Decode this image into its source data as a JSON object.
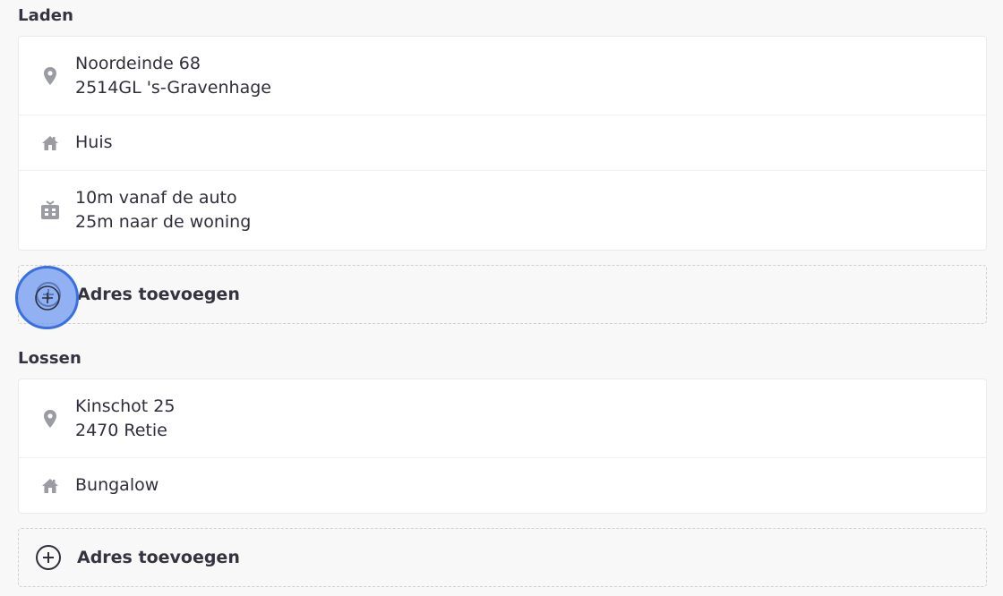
{
  "sections": [
    {
      "title": "Laden",
      "rows": [
        {
          "icon": "location-pin-icon",
          "lines": [
            "Noordeinde 68",
            "2514GL 's-Gravenhage"
          ]
        },
        {
          "icon": "house-icon",
          "lines": [
            "Huis"
          ]
        },
        {
          "icon": "elevator-icon",
          "lines": [
            "10m vanaf de auto",
            "25m naar de woning"
          ]
        }
      ],
      "add_label": "Adres toevoegen"
    },
    {
      "title": "Lossen",
      "rows": [
        {
          "icon": "location-pin-icon",
          "lines": [
            "Kinschot 25",
            "2470 Retie"
          ]
        },
        {
          "icon": "house-icon",
          "lines": [
            "Bungalow"
          ]
        }
      ],
      "add_label": "Adres toevoegen"
    }
  ],
  "colors": {
    "icon_gray": "#9b9ba3",
    "text": "#2f2e3b",
    "click_highlight": "#3a6fe0"
  }
}
